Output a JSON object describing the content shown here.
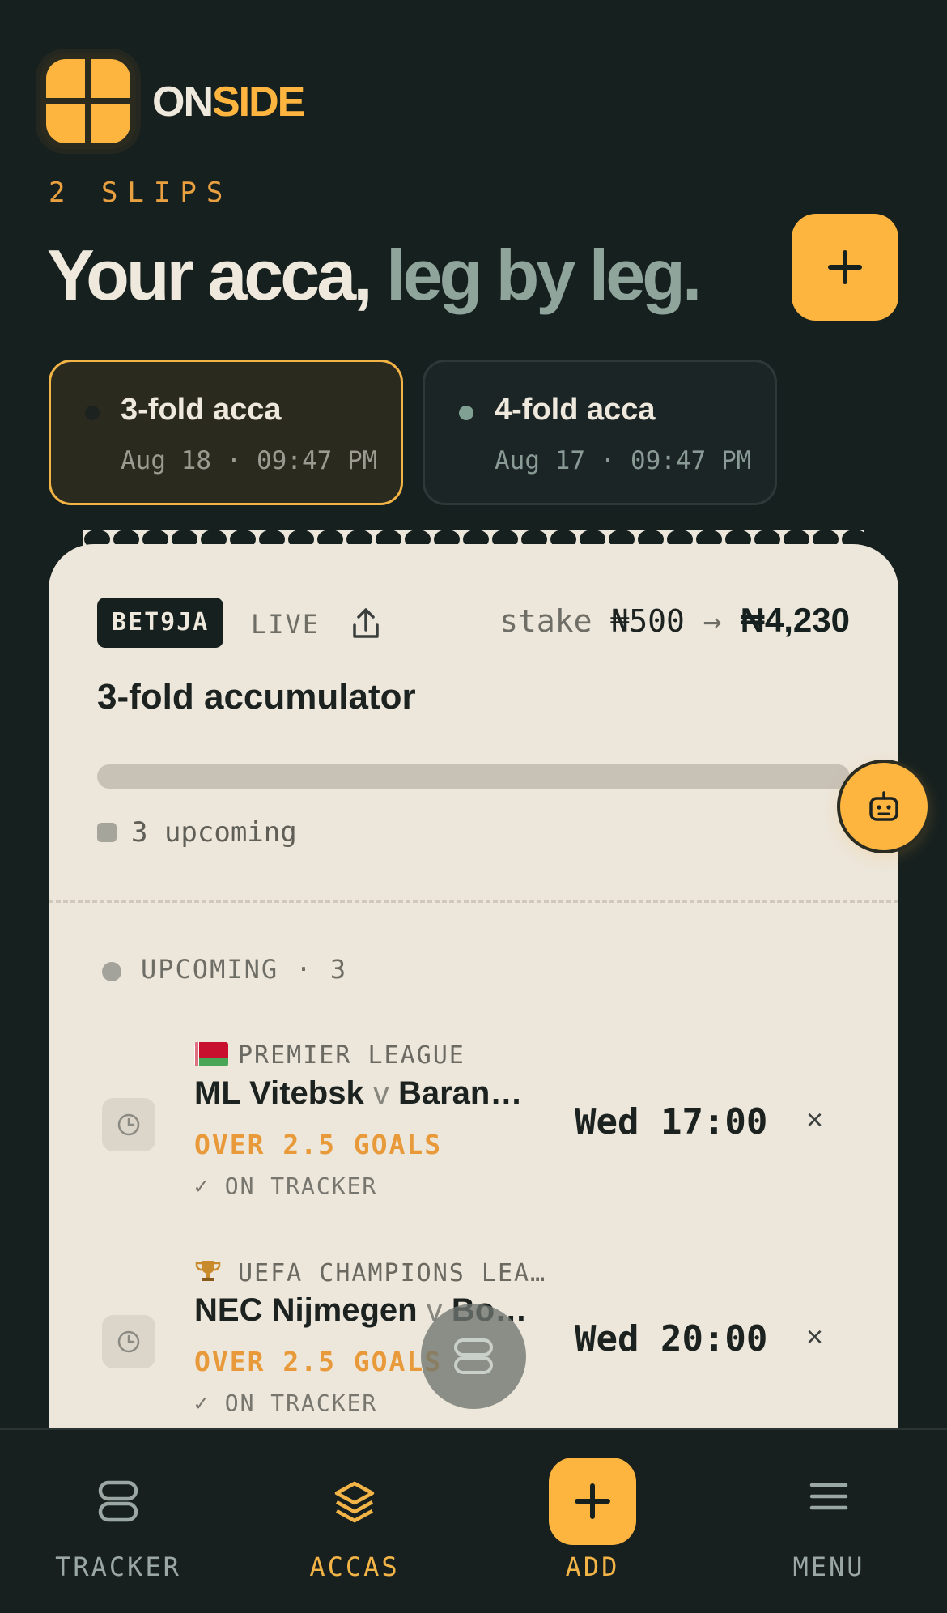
{
  "brand": {
    "part1": "ON",
    "part2": "SIDE"
  },
  "slips_count": "2 SLIPS",
  "headline": {
    "white": "Your acca,",
    "muted": "leg by leg."
  },
  "tabs": [
    {
      "title": "3-fold acca",
      "date": "Aug 18 · 09:47 PM",
      "active": true
    },
    {
      "title": "4-fold acca",
      "date": "Aug 17 · 09:47 PM",
      "active": false
    }
  ],
  "ticket": {
    "bookmaker": "BET9JA",
    "status": "LIVE",
    "stake_label": "stake",
    "stake_amount": "₦500",
    "arrow": "→",
    "potential": "₦4,230",
    "title": "3-fold accumulator",
    "progress_summary": "3 upcoming",
    "section_label": "UPCOMING · 3",
    "legs": [
      {
        "competition": "PREMIER LEAGUE",
        "home": "ML Vitebsk",
        "vs": "v",
        "away": "Barano…",
        "pick": "OVER 2.5 GOALS",
        "tracker": "✓ ON TRACKER",
        "time": "Wed 17:00",
        "remove": "×"
      },
      {
        "competition": "UEFA CHAMPIONS LEA…",
        "home": "NEC Nijmegen",
        "vs": "v",
        "away": "Bod…",
        "pick": "OVER 2.5 GOALS",
        "tracker": "✓ ON TRACKER",
        "time": "Wed 20:00",
        "remove": "×"
      }
    ]
  },
  "nav": {
    "tracker": "TRACKER",
    "accas": "ACCAS",
    "add": "ADD",
    "menu": "MENU"
  },
  "colors": {
    "accent": "#fdb53f",
    "background": "#16201f",
    "ticket": "#ede6da"
  }
}
